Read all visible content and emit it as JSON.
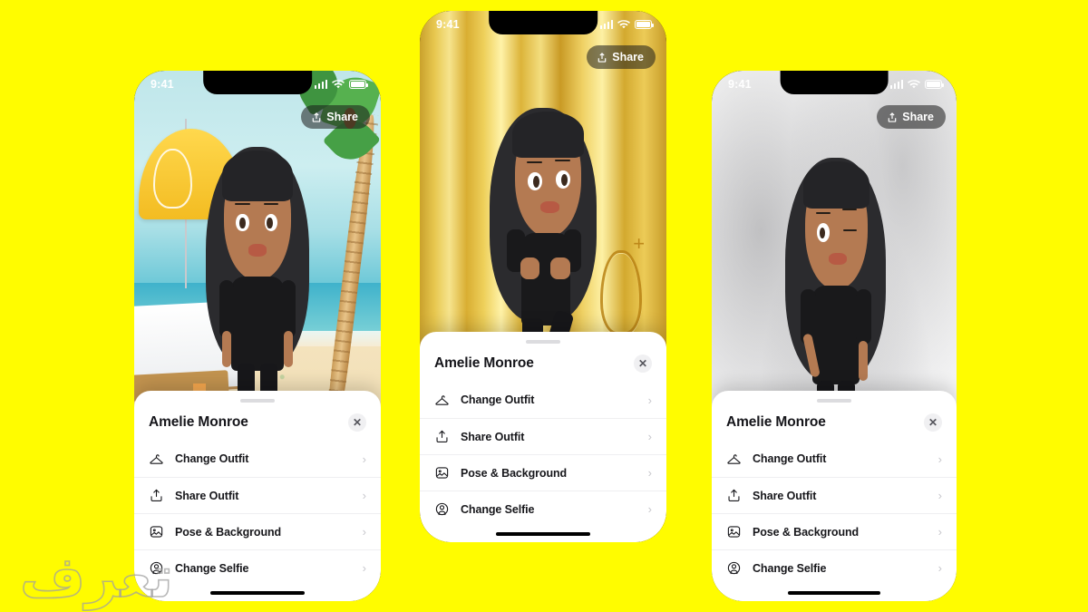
{
  "page": {
    "background_color": "#FFFC00",
    "watermark_text": "تعرف"
  },
  "status_bar": {
    "time": "9:41",
    "signal_icon": "cellular-bars-icon",
    "wifi_icon": "wifi-icon",
    "battery_icon": "battery-full-icon"
  },
  "share_button": {
    "label": "Share",
    "icon": "share-upload-icon"
  },
  "sheet": {
    "title": "Amelie Monroe",
    "close_label": "✕",
    "grabber": "drag-handle",
    "rows": [
      {
        "label": "Change Outfit",
        "icon": "hanger-icon",
        "chevron": "›"
      },
      {
        "label": "Share Outfit",
        "icon": "upload-icon",
        "chevron": "›"
      },
      {
        "label": "Pose & Background",
        "icon": "photo-frame-icon",
        "chevron": "›"
      },
      {
        "label": "Change Selfie",
        "icon": "person-circle-icon",
        "chevron": "›"
      }
    ]
  },
  "phones": [
    {
      "id": "phone-left",
      "scene": "beach",
      "scene_label": "Beach background with umbrella, palm tree and lounger",
      "avatar_pose": "standing-hands-on-hips",
      "accent_color": "#FFD84D"
    },
    {
      "id": "phone-center",
      "scene": "gold",
      "scene_label": "Gold metallic background with embossed Snapchat ghost",
      "avatar_pose": "dancing-leg-up",
      "accent_color": "#E7C74F"
    },
    {
      "id": "phone-right",
      "scene": "marble",
      "scene_label": "White marble background",
      "avatar_pose": "winking-hand-up",
      "accent_color": "#F1F1F2"
    }
  ]
}
